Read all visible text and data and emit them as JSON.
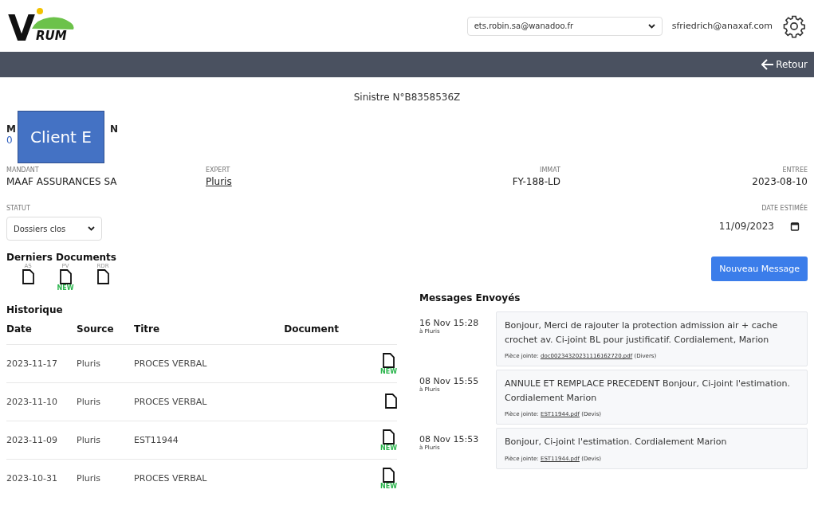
{
  "logo": {
    "big": "V",
    "small": "RUM"
  },
  "header": {
    "account_select": "ets.robin.sa@wanadoo.fr",
    "user": "sfriedrich@anaxaf.com"
  },
  "nav": {
    "back": "Retour"
  },
  "title": "Sinistre N°B8358536Z",
  "client": {
    "name_start": "M",
    "name_end": "N",
    "phone_start": "0",
    "overlay": "Client E"
  },
  "fields": [
    {
      "label": "MANDANT",
      "value": "MAAF ASSURANCES SA",
      "kind": "text"
    },
    {
      "label": "EXPERT",
      "value": "Pluris",
      "kind": "link"
    },
    {
      "label": "IMMAT",
      "value": "FY-188-LD",
      "kind": "text"
    },
    {
      "label": "ENTREE",
      "value": "2023-08-10",
      "kind": "text"
    }
  ],
  "statut": {
    "label": "STATUT",
    "value": "Dossiers clos"
  },
  "date_estimee": {
    "label": "DATE ESTIMÉE",
    "value": "11/09/2023"
  },
  "derniers_documents": {
    "title": "Derniers Documents",
    "items": [
      {
        "label": "AS"
      },
      {
        "label": "PV",
        "badge": "NEW"
      },
      {
        "label": "RDR"
      }
    ]
  },
  "historique": {
    "title": "Historique",
    "columns": [
      "Date",
      "Source",
      "Titre",
      "Document"
    ],
    "rows": [
      {
        "date": "2023-11-17",
        "source": "Pluris",
        "titre": "PROCES VERBAL",
        "badge": "NEW"
      },
      {
        "date": "2023-11-10",
        "source": "Pluris",
        "titre": "PROCES VERBAL"
      },
      {
        "date": "2023-11-09",
        "source": "Pluris",
        "titre": "EST11944",
        "badge": "NEW"
      },
      {
        "date": "2023-10-31",
        "source": "Pluris",
        "titre": "PROCES VERBAL",
        "badge": "NEW"
      }
    ]
  },
  "new_message_button": "Nouveau Message",
  "messages": {
    "title": "Messages Envoyés",
    "items": [
      {
        "time": "16 Nov 15:28",
        "to": "à Pluris",
        "body": "Bonjour, Merci de rajouter la protection admission air + cache crochet av. Ci-joint BL pour justificatif. Cordialement, Marion",
        "attachment_label": "Pièce jointe:",
        "file": "doc00234320231116162720.pdf",
        "type": "(Divers)"
      },
      {
        "time": "08 Nov 15:55",
        "to": "à Pluris",
        "body": "ANNULE ET REMPLACE PRECEDENT Bonjour, Ci-joint l'estimation. Cordialement Marion",
        "attachment_label": "Pièce jointe:",
        "file": "EST11944.pdf",
        "type": "(Devis)"
      },
      {
        "time": "08 Nov 15:53",
        "to": "à Pluris",
        "body": "Bonjour, Ci-joint l'estimation. Cordialement Marion",
        "attachment_label": "Pièce jointe:",
        "file": "EST11944.pdf",
        "type": "(Devis)"
      }
    ]
  }
}
